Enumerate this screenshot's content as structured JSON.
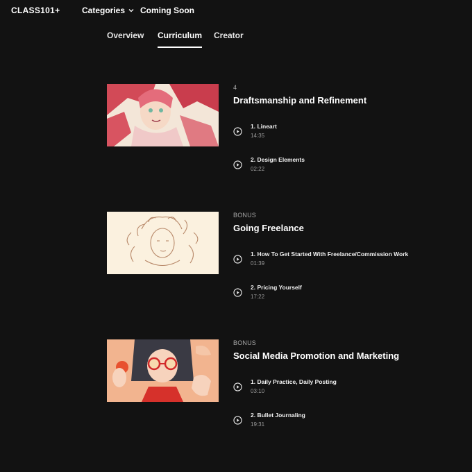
{
  "header": {
    "logo": "CLASS101+",
    "nav": {
      "categories": "Categories",
      "coming_soon": "Coming Soon"
    }
  },
  "tabs": [
    "Overview",
    "Curriculum",
    "Creator"
  ],
  "active_tab": "Curriculum",
  "sections": [
    {
      "label": "4",
      "title": "Draftsmanship and Refinement",
      "lessons": [
        {
          "title": "1. Lineart",
          "duration": "14:35"
        },
        {
          "title": "2. Design Elements",
          "duration": "02:22"
        }
      ]
    },
    {
      "label": "BONUS",
      "title": "Going Freelance",
      "lessons": [
        {
          "title": "1. How To Get Started With Freelance/Commission Work",
          "duration": "01:39"
        },
        {
          "title": "2. Pricing Yourself",
          "duration": "17:22"
        }
      ]
    },
    {
      "label": "BONUS",
      "title": "Social Media Promotion and Marketing",
      "lessons": [
        {
          "title": "1. Daily Practice, Daily Posting",
          "duration": "03:10"
        },
        {
          "title": "2. Bullet Journaling",
          "duration": "19:31"
        }
      ]
    }
  ],
  "colors": {
    "background": "#121212",
    "text": "#ffffff",
    "muted": "#9a9a9a"
  }
}
